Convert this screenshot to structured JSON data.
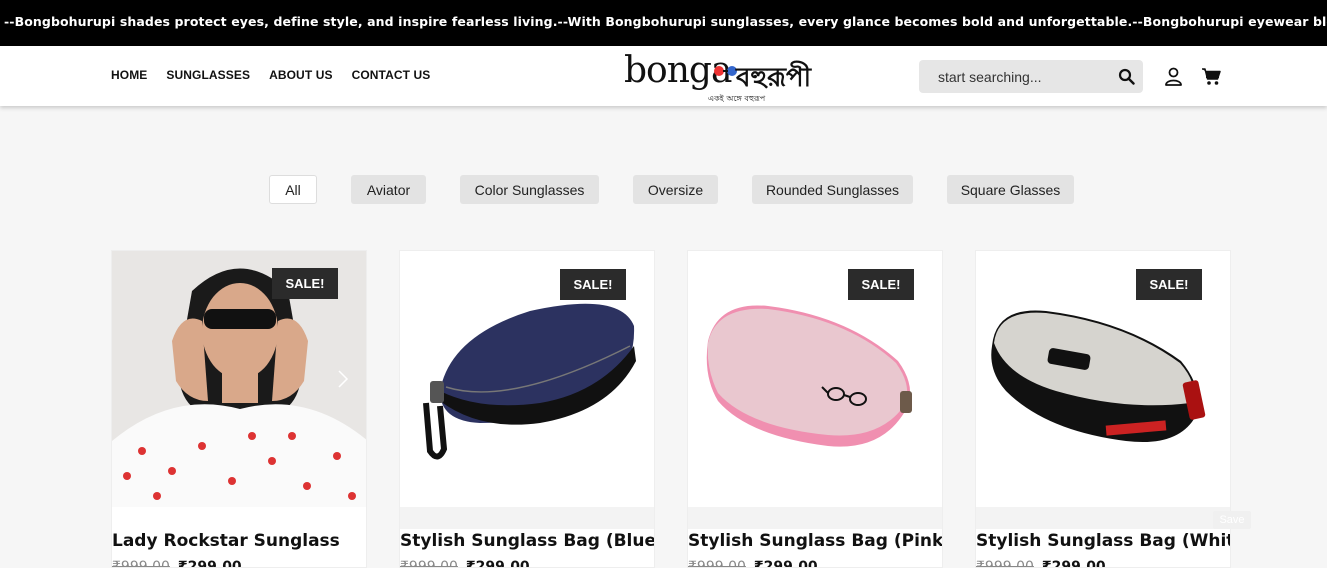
{
  "marquee": {
    "text": "--Bongbohurupi shades protect eyes, define style, and inspire fearless living.--With Bongbohurupi sunglasses, every glance becomes bold and unforgettable.--Bongbohurupi eyewear blends tradition, fashion, and c"
  },
  "nav": {
    "items": [
      "HOME",
      "SUNGLASSES",
      "ABOUT US",
      "CONTACT US"
    ]
  },
  "logo": {
    "text": "bonga",
    "script_text": "বহুরূপী",
    "tagline": "একই অঙ্গে বহুরূপ"
  },
  "search": {
    "placeholder": "start searching..."
  },
  "filters": [
    "All",
    "Aviator",
    "Color Sunglasses",
    "Oversize",
    "Rounded Sunglasses",
    "Square Glasses"
  ],
  "products": [
    {
      "name": "Lady Rockstar Sunglass",
      "badge": "SALE!",
      "old_price": "₹999.00",
      "price": "₹299.00"
    },
    {
      "name": "Stylish Sunglass Bag (Blue)",
      "badge": "SALE!",
      "old_price": "₹999.00",
      "price": "₹299.00"
    },
    {
      "name": "Stylish Sunglass Bag (Pink)",
      "badge": "SALE!",
      "old_price": "₹999.00",
      "price": "₹299.00"
    },
    {
      "name": "Stylish Sunglass Bag (White)",
      "badge": "SALE!",
      "old_price": "₹999.00",
      "price": "₹299.00"
    }
  ],
  "save_label": "Save",
  "colors": {
    "marquee_bg": "#000000",
    "badge_bg": "#2b2b2b",
    "filter_bg": "#e3e3e3",
    "page_bg": "#f6f6f6"
  }
}
